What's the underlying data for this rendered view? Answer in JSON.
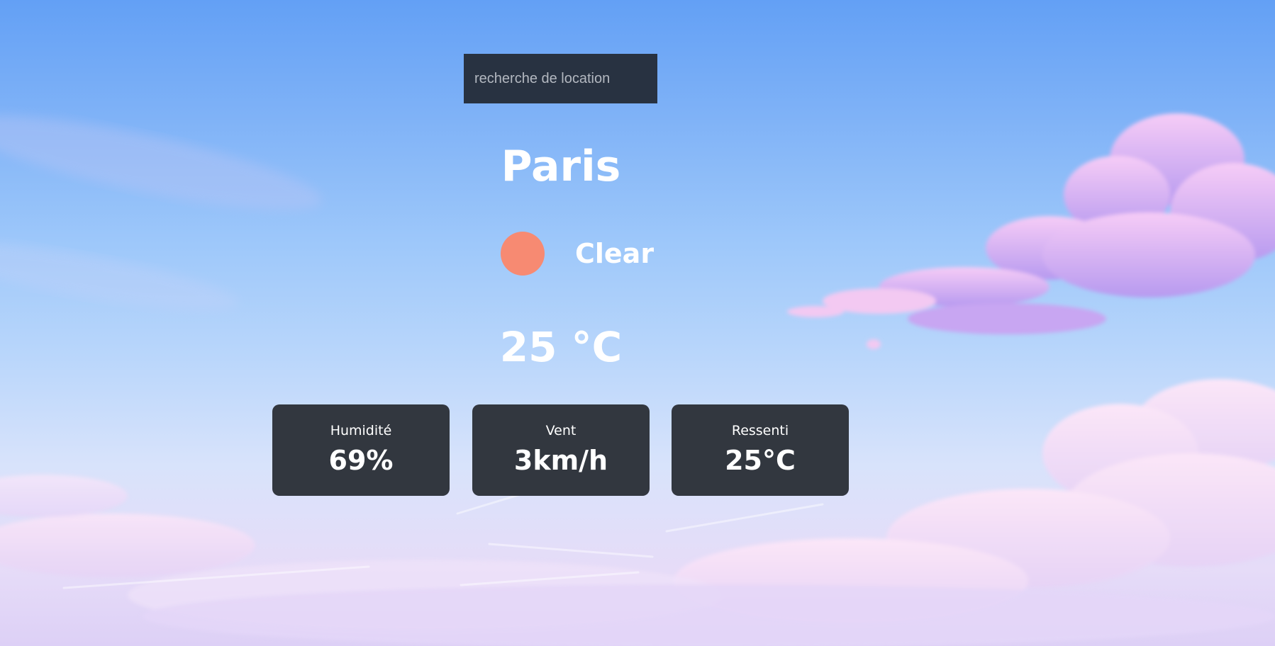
{
  "search": {
    "placeholder": "recherche de location",
    "value": ""
  },
  "weather": {
    "city": "Paris",
    "condition": "Clear",
    "condition_icon": "sun-icon",
    "temperature": "25 °C"
  },
  "stats": [
    {
      "label": "Humidité",
      "value": "69%"
    },
    {
      "label": "Vent",
      "value": "3km/h"
    },
    {
      "label": "Ressenti",
      "value": "25°C"
    }
  ],
  "colors": {
    "sun": "#f78a72",
    "card_bg": "#32373f",
    "search_bg": "#283241",
    "sky_top": "#63a0f5",
    "clouds": "#e8c6f4"
  }
}
